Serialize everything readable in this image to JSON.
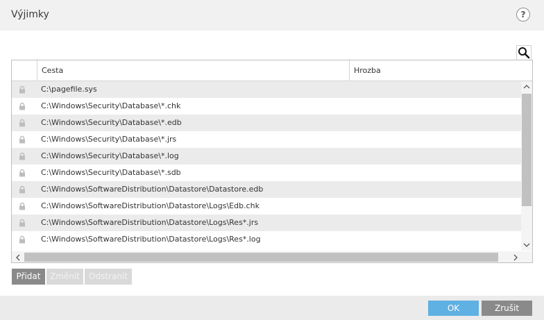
{
  "window": {
    "title": "Výjimky",
    "help_label": "?"
  },
  "table": {
    "columns": [
      {
        "label": ""
      },
      {
        "label": "Cesta"
      },
      {
        "label": "Hrozba"
      }
    ],
    "rows": [
      {
        "path": "C:\\pagefile.sys",
        "threat": "",
        "locked": true
      },
      {
        "path": "C:\\Windows\\Security\\Database\\*.chk",
        "threat": "",
        "locked": true
      },
      {
        "path": "C:\\Windows\\Security\\Database\\*.edb",
        "threat": "",
        "locked": true
      },
      {
        "path": "C:\\Windows\\Security\\Database\\*.jrs",
        "threat": "",
        "locked": true
      },
      {
        "path": "C:\\Windows\\Security\\Database\\*.log",
        "threat": "",
        "locked": true
      },
      {
        "path": "C:\\Windows\\Security\\Database\\*.sdb",
        "threat": "",
        "locked": true
      },
      {
        "path": "C:\\Windows\\SoftwareDistribution\\Datastore\\Datastore.edb",
        "threat": "",
        "locked": true
      },
      {
        "path": "C:\\Windows\\SoftwareDistribution\\Datastore\\Logs\\Edb.chk",
        "threat": "",
        "locked": true
      },
      {
        "path": "C:\\Windows\\SoftwareDistribution\\Datastore\\Logs\\Res*.jrs",
        "threat": "",
        "locked": true
      },
      {
        "path": "C:\\Windows\\SoftwareDistribution\\Datastore\\Logs\\Res*.log",
        "threat": "",
        "locked": true
      }
    ]
  },
  "actions": {
    "add_label": "Přidat",
    "edit_label": "Změnit",
    "remove_label": "Odstranit"
  },
  "footer": {
    "ok_label": "OK",
    "cancel_label": "Zrušit"
  },
  "icons": {
    "lock": "lock-icon",
    "search": "search-icon",
    "help": "help-icon"
  },
  "colors": {
    "ok_button": "#5fb0e3",
    "cancel_button": "#8a8a8a",
    "row_alt": "#ebebeb"
  }
}
